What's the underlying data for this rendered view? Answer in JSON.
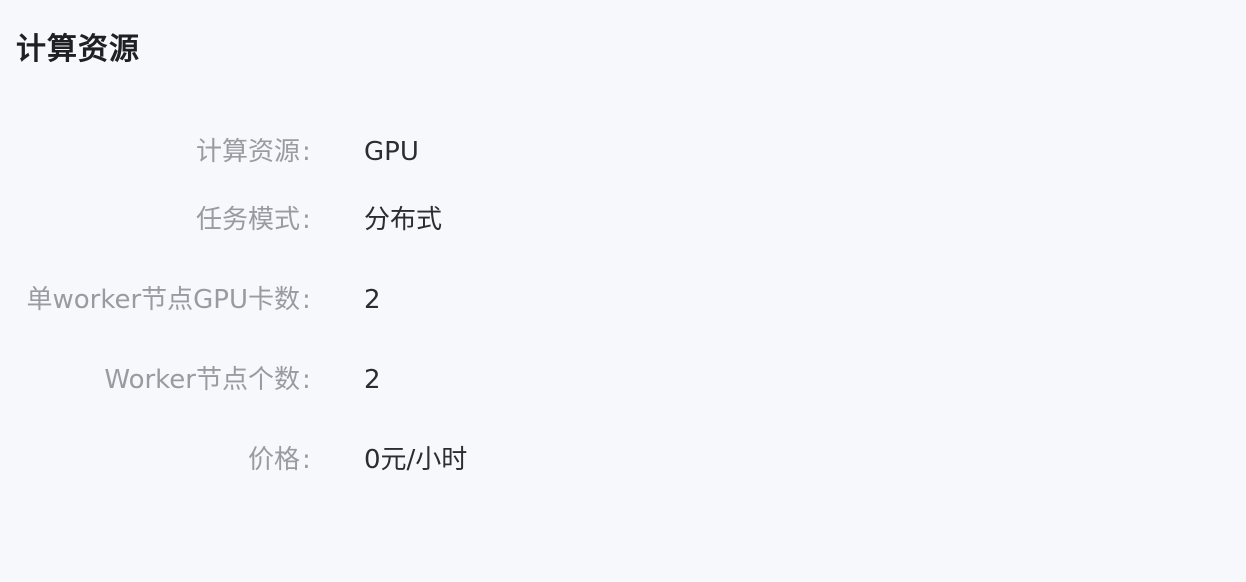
{
  "section": {
    "title": "计算资源"
  },
  "fields": [
    {
      "label": "计算资源",
      "value": "GPU"
    },
    {
      "label": "任务模式",
      "value": "分布式"
    },
    {
      "label": "单worker节点GPU卡数",
      "value": "2"
    },
    {
      "label": "Worker节点个数",
      "value": "2"
    },
    {
      "label": "价格",
      "value": "0元/小时"
    }
  ],
  "colon": ":"
}
